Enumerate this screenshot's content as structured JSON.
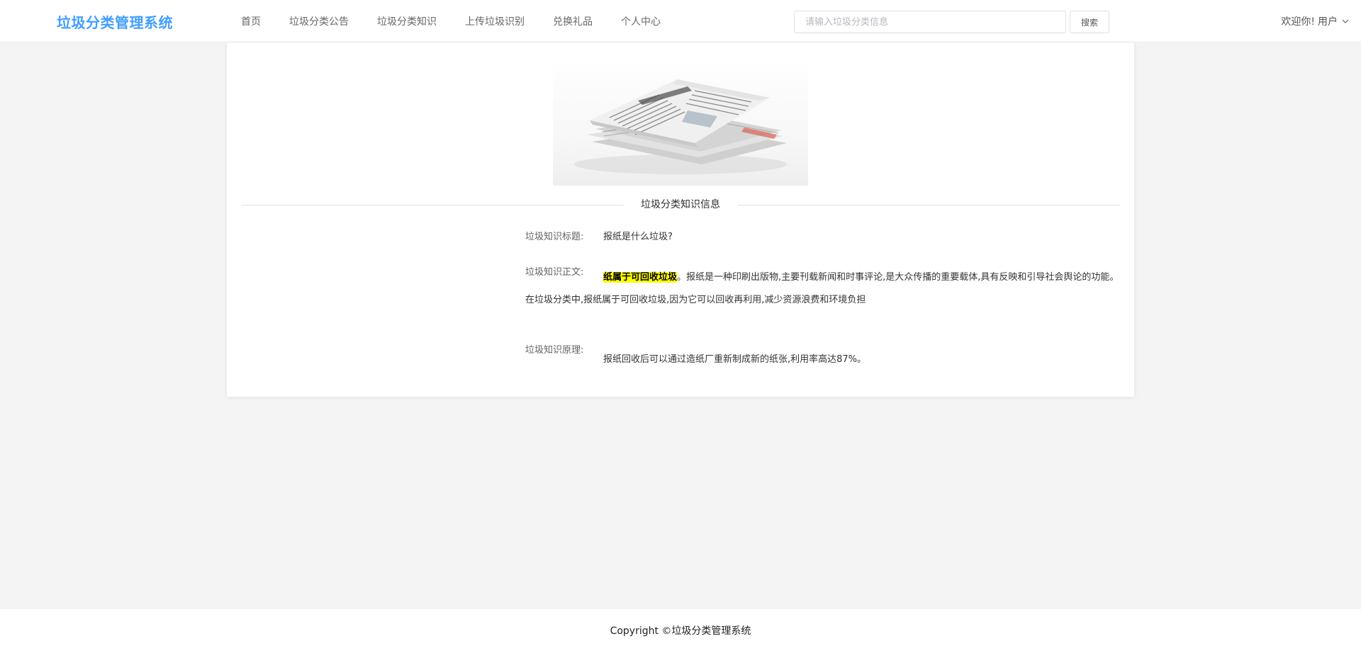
{
  "header": {
    "logo": "垃圾分类管理系统",
    "nav": [
      "首页",
      "垃圾分类公告",
      "垃圾分类知识",
      "上传垃圾识别",
      "兑换礼品",
      "个人中心"
    ],
    "search": {
      "placeholder": "请输入垃圾分类信息",
      "button_label": "搜索"
    },
    "welcome": "欢迎你!",
    "user": "用户",
    "user_menu_icon": "chevron-down-icon"
  },
  "knowledge": {
    "image": "newspaper-stack-image",
    "section_title": "垃圾分类知识信息",
    "title_label": "垃圾知识标题:",
    "title_value": "报纸是什么垃圾?",
    "body_label": "垃圾知识正文:",
    "body_highlight": "纸属于可回收垃圾",
    "body_rest": "。报纸是一种印刷出版物,主要刊载新闻和时事评论,是大众传播的重要载体,具有反映和引导社会舆论的功能。在垃圾分类中,报纸属于可回收垃圾,因为它可以回收再利用,减少资源浪费和环境负担",
    "principle_label": "垃圾知识原理:",
    "principle_value": "报纸回收后可以通过造纸厂重新制成新的纸张,利用率高达87%。"
  },
  "footer": {
    "copyright": "Copyright ©垃圾分类管理系统"
  },
  "colors": {
    "brand": "#409eff",
    "highlight": "#ffff00",
    "page_background": "#f4f4f4"
  }
}
